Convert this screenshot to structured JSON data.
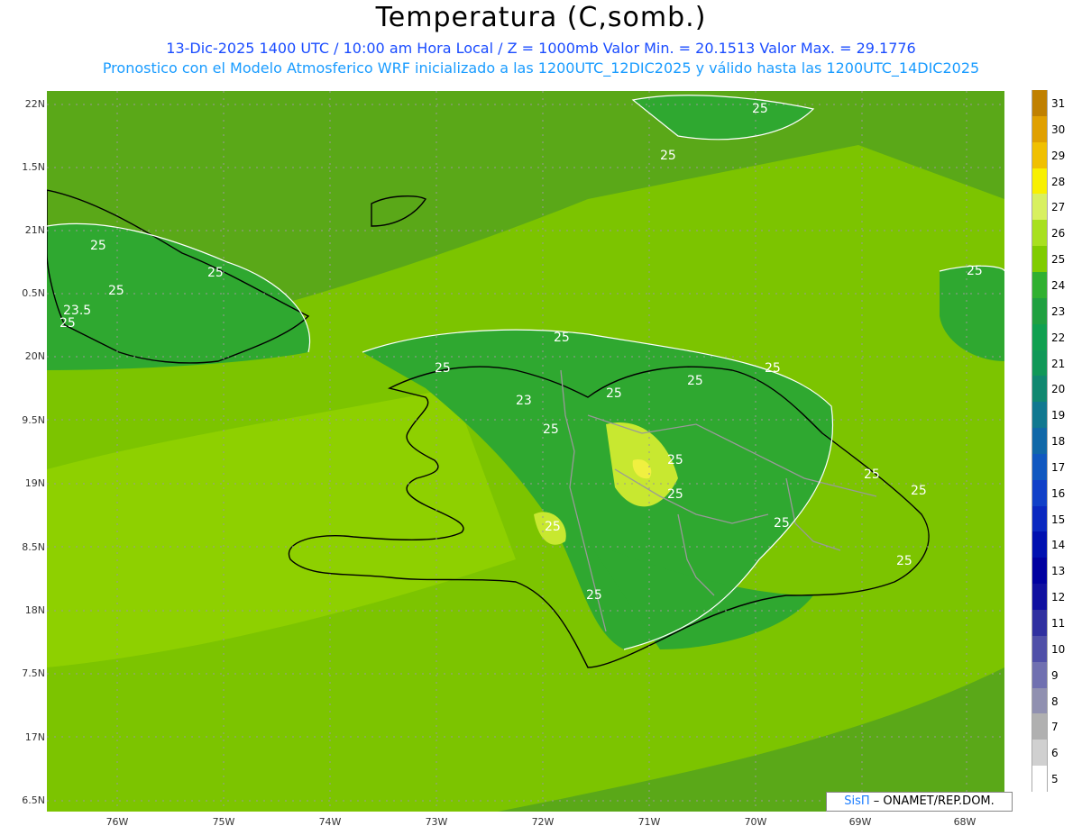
{
  "header": {
    "title": "Temperatura (C,somb.)",
    "line1": "13-Dic-2025 1400 UTC / 10:00 am Hora Local / Z = 1000mb  Valor Min. = 20.1513  Valor Max. = 29.1776",
    "line2": "Pronostico con el Modelo Atmosferico WRF inicializado a las 1200UTC_12DIC2025 y válido hasta las  1200UTC_14DIC2025"
  },
  "axes": {
    "lat_labels": [
      "22N",
      "1.5N",
      "21N",
      "0.5N",
      "20N",
      "9.5N",
      "19N",
      "8.5N",
      "18N",
      "7.5N",
      "17N",
      "6.5N"
    ],
    "lon_labels": [
      "76W",
      "75W",
      "74W",
      "73W",
      "72W",
      "71W",
      "70W",
      "69W",
      "68W"
    ]
  },
  "contour_labels": [
    "25",
    "25",
    "25",
    "25",
    "23.5",
    "25",
    "25",
    "25",
    "23",
    "25",
    "25",
    "25",
    "25",
    "25",
    "25",
    "25",
    "25",
    "25",
    "25",
    "25",
    "25",
    "25",
    "25"
  ],
  "colorbar": {
    "labels": [
      "31",
      "30",
      "29",
      "28",
      "27",
      "26",
      "25",
      "24",
      "23",
      "22",
      "21",
      "20",
      "19",
      "18",
      "17",
      "16",
      "15",
      "14",
      "13",
      "12",
      "11",
      "10",
      "9",
      "8",
      "7",
      "6",
      "5"
    ],
    "colors": [
      "#c08000",
      "#e0a000",
      "#f0c000",
      "#f8f000",
      "#d8f060",
      "#a8e020",
      "#80cc00",
      "#30b030",
      "#20a040",
      "#10a050",
      "#109858",
      "#108870",
      "#107890",
      "#1068a8",
      "#1058c0",
      "#1040c8",
      "#0a28c0",
      "#0010b0",
      "#0000a0",
      "#1010a0",
      "#3030a0",
      "#5050a8",
      "#7070b0",
      "#9090b0",
      "#b0b0b0",
      "#d0d0d0",
      "#ffffff"
    ]
  },
  "credit": {
    "sis": "SisΠ",
    "rest": " – ONAMET/REP.DOM."
  }
}
